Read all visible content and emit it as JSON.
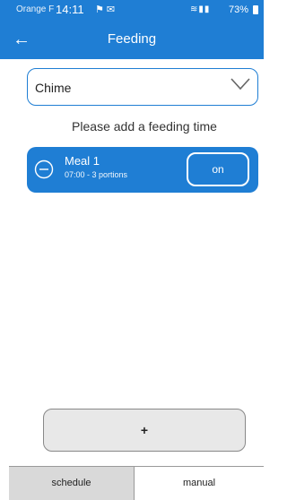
{
  "status_bar": {
    "carrier": "Orange F",
    "time": "14:11",
    "battery": "73%"
  },
  "app_bar": {
    "back_icon": "arrow-left-icon",
    "title": "Feeding"
  },
  "device_select": {
    "value": "Chime",
    "icon": "chevron-down-icon"
  },
  "hint_text": "Please add a feeding time",
  "meals": [
    {
      "title": "Meal 1",
      "details": "07:00 - 3 portions",
      "toggle_label": "on",
      "remove_icon": "minus-circle-icon"
    }
  ],
  "add_button": "+",
  "tabs": [
    {
      "label": "schedule",
      "active": true
    },
    {
      "label": "manual",
      "active": false
    }
  ],
  "colors": {
    "primary": "#1f7ed4",
    "tab_active_bg": "#d9d9d9",
    "add_button_bg": "#e8e8e8"
  }
}
